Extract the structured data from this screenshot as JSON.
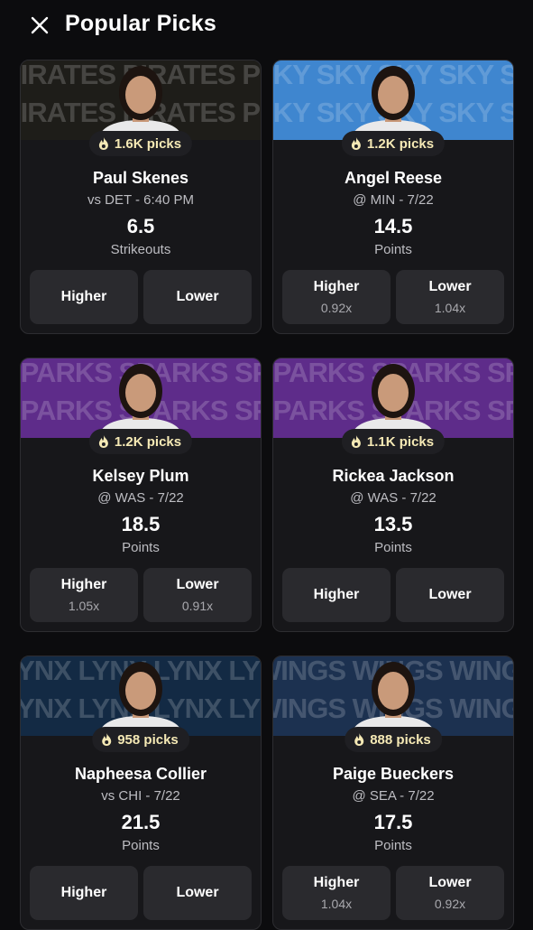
{
  "header": {
    "title": "Popular Picks"
  },
  "cards": [
    {
      "banner_text": "PIRATES PIRATES PIRATES",
      "banner_color": "#1e1d19",
      "picks": "1.6K picks",
      "name": "Paul Skenes",
      "matchup": "vs DET - 6:40 PM",
      "line": "6.5",
      "stat": "Strikeouts",
      "higher": {
        "label": "Higher",
        "mult": ""
      },
      "lower": {
        "label": "Lower",
        "mult": ""
      }
    },
    {
      "banner_text": "SKY SKY SKY SKY SKY SKY",
      "banner_color": "#3f86cf",
      "picks": "1.2K picks",
      "name": "Angel Reese",
      "matchup": "@ MIN - 7/22",
      "line": "14.5",
      "stat": "Points",
      "higher": {
        "label": "Higher",
        "mult": "0.92x"
      },
      "lower": {
        "label": "Lower",
        "mult": "1.04x"
      }
    },
    {
      "banner_text": "SPARKS SPARKS SPARKS",
      "banner_color": "#5e2c8a",
      "picks": "1.2K picks",
      "name": "Kelsey Plum",
      "matchup": "@ WAS - 7/22",
      "line": "18.5",
      "stat": "Points",
      "higher": {
        "label": "Higher",
        "mult": "1.05x"
      },
      "lower": {
        "label": "Lower",
        "mult": "0.91x"
      }
    },
    {
      "banner_text": "SPARKS SPARKS SPARKS",
      "banner_color": "#5e2c8a",
      "picks": "1.1K picks",
      "name": "Rickea Jackson",
      "matchup": "@ WAS - 7/22",
      "line": "13.5",
      "stat": "Points",
      "higher": {
        "label": "Higher",
        "mult": ""
      },
      "lower": {
        "label": "Lower",
        "mult": ""
      }
    },
    {
      "banner_text": "LYNX LYNX LYNX LYNX",
      "banner_color": "#132a44",
      "picks": "958 picks",
      "name": "Napheesa Collier",
      "matchup": "vs CHI - 7/22",
      "line": "21.5",
      "stat": "Points",
      "higher": {
        "label": "Higher",
        "mult": ""
      },
      "lower": {
        "label": "Lower",
        "mult": ""
      }
    },
    {
      "banner_text": "WINGS WINGS WINGS WINGS",
      "banner_color": "#1c3150",
      "picks": "888 picks",
      "name": "Paige Bueckers",
      "matchup": "@ SEA - 7/22",
      "line": "17.5",
      "stat": "Points",
      "higher": {
        "label": "Higher",
        "mult": "1.04x"
      },
      "lower": {
        "label": "Lower",
        "mult": "0.92x"
      }
    }
  ],
  "icons": {
    "close": "close-icon",
    "fire": "fire-icon"
  },
  "colors": {
    "background": "#0c0c0e",
    "card": "#17171a",
    "button": "#2a2a2e",
    "picks_text": "#f5e9b5"
  }
}
